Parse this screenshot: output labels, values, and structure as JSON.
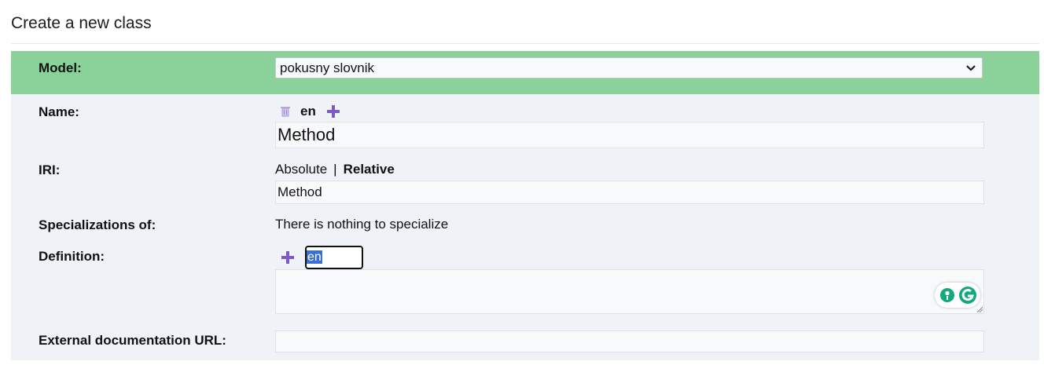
{
  "page": {
    "title": "Create a new class"
  },
  "model": {
    "label": "Model:",
    "selected": "pokusny slovnik"
  },
  "name": {
    "label": "Name:",
    "language": "en",
    "value": "Method"
  },
  "iri": {
    "label": "IRI:",
    "option_absolute": "Absolute",
    "separator": "|",
    "option_relative": "Relative",
    "value": "Method"
  },
  "specializations": {
    "label": "Specializations of:",
    "message": "There is nothing to specialize"
  },
  "definition": {
    "label": "Definition:",
    "language_input_value": "en",
    "value": ""
  },
  "external_docs": {
    "label": "External documentation URL:",
    "value": ""
  },
  "icons": {
    "delete_language": "trash-icon",
    "add_language": "plus-icon",
    "grammarly": "grammarly-icon",
    "dropdown": "chevron-down-icon"
  },
  "colors": {
    "model_row_bg": "#8ad29a",
    "panel_bg": "#eff2f7",
    "plus_icon": "#7b5cc4",
    "selection_bg": "#3b6fd1",
    "grammarly_green": "#15a87a"
  }
}
